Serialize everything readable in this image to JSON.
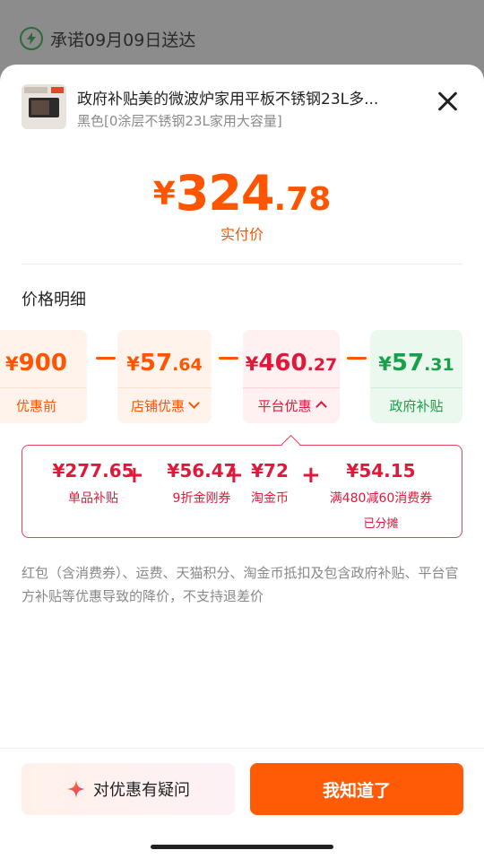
{
  "background": {
    "promise_text": "承诺09月09日送达"
  },
  "product": {
    "title": "政府补贴美的微波炉家用平板不锈钢23L多...",
    "spec": "黑色[0涂层不锈钢23L家用大容量]"
  },
  "price": {
    "currency": "¥",
    "integer": "324",
    "decimal": ".78",
    "label": "实付价"
  },
  "section_title": "价格明细",
  "breakdown": [
    {
      "currency": "¥",
      "integer": "900",
      "decimal": "",
      "label": "优惠前"
    },
    {
      "currency": "¥",
      "integer": "57",
      "decimal": ".64",
      "label": "店铺优惠"
    },
    {
      "currency": "¥",
      "integer": "460",
      "decimal": ".27",
      "label": "平台优惠"
    },
    {
      "currency": "¥",
      "integer": "57",
      "decimal": ".31",
      "label": "政府补贴"
    }
  ],
  "platform_detail": [
    {
      "value": "¥277.65",
      "name": "单品补贴",
      "sub": ""
    },
    {
      "value": "¥56.47",
      "name": "9折金刚券",
      "sub": ""
    },
    {
      "value": "¥72",
      "name": "淘金币",
      "sub": ""
    },
    {
      "value": "¥54.15",
      "name": "满480减60消费券",
      "sub": "已分摊"
    }
  ],
  "note": "红包（含消费券）、运费、天猫积分、淘金币抵扣及包含政府补贴、平台官方补贴等优惠导致的降价，不支持退差价",
  "footer": {
    "ask_label": "对优惠有疑问",
    "ok_label": "我知道了"
  },
  "colors": {
    "accent": "#ff5500",
    "platform_red": "#e0193b",
    "government_green": "#19a04b"
  }
}
